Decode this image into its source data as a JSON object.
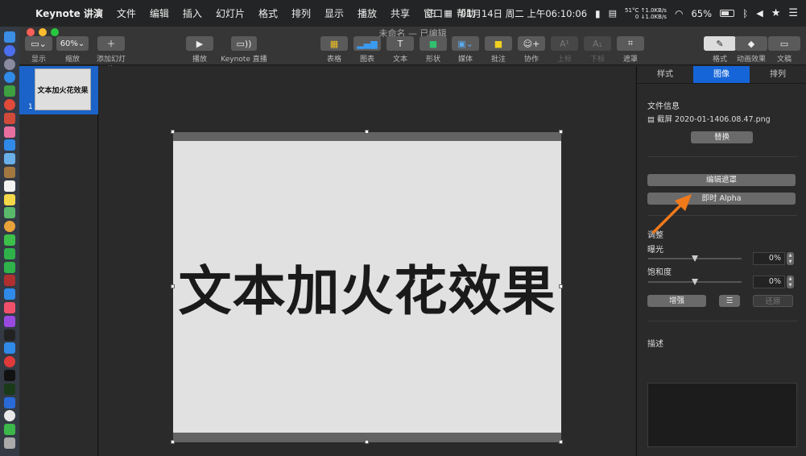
{
  "menubar": {
    "items": [
      "Keynote 讲演",
      "文件",
      "编辑",
      "插入",
      "幻灯片",
      "格式",
      "排列",
      "显示",
      "播放",
      "共享",
      "窗口",
      "帮助"
    ],
    "status": {
      "datetime": "01月14日 周二 上午06:10:06",
      "temp": "51°C",
      "net_up": "↑1.0KB/s",
      "net_zero": "0",
      "net_down": "↓1.0KB/s",
      "battery": "65%"
    }
  },
  "window": {
    "title": "未命名 — 已编辑",
    "toolbar": {
      "view": "显示",
      "zoom_value": "60%",
      "zoom": "缩放",
      "add_slide": "添加幻灯片",
      "play": "播放",
      "live": "Keynote 直播",
      "table": "表格",
      "chart": "图表",
      "text": "文本",
      "shape": "形状",
      "media": "媒体",
      "comment": "批注",
      "collab": "协作",
      "superscript": "上标",
      "subscript": "下标",
      "mask": "遮罩",
      "format": "格式",
      "animate": "动画效果",
      "document": "文稿"
    }
  },
  "navigator": {
    "slide_num": "1",
    "thumb_text": "文本加火花效果"
  },
  "slide": {
    "text": "文本加火花效果"
  },
  "inspector": {
    "tabs": [
      "样式",
      "图像",
      "排列"
    ],
    "file_info_title": "文件信息",
    "filename": "截屏 2020-01-1406.08.47.png",
    "replace": "替换",
    "edit_mask": "编辑遮罩",
    "instant_alpha": "即时 Alpha",
    "adjust_title": "调整",
    "exposure_label": "曝光",
    "exposure_value": "0%",
    "saturation_label": "饱和度",
    "saturation_value": "0%",
    "enhance": "增强",
    "revert": "还原",
    "description_title": "描述"
  },
  "colors": {
    "accent": "#1565d8",
    "arrow": "#f07a1a"
  }
}
